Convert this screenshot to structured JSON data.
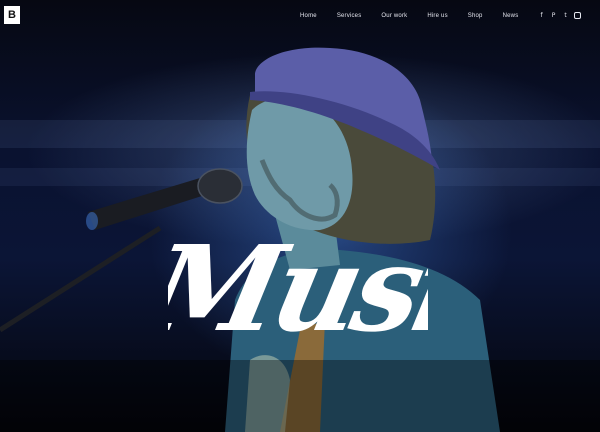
{
  "site": {
    "logo_letter": "B"
  },
  "nav": {
    "items": [
      {
        "label": "Home"
      },
      {
        "label": "Services"
      },
      {
        "label": "Our work"
      },
      {
        "label": "Hire us"
      },
      {
        "label": "Shop"
      },
      {
        "label": "News"
      }
    ]
  },
  "social": {
    "icons": [
      "facebook-icon",
      "pinterest-icon",
      "twitter-icon",
      "instagram-icon"
    ],
    "glyphs": [
      "f",
      "P",
      "t",
      ""
    ]
  },
  "hero": {
    "title": "Musi",
    "image_subject": "singer with hat at microphone on stage",
    "colors": {
      "background": "#05060d",
      "stage_light": "#3c6ebe",
      "title": "#ffffff"
    }
  }
}
